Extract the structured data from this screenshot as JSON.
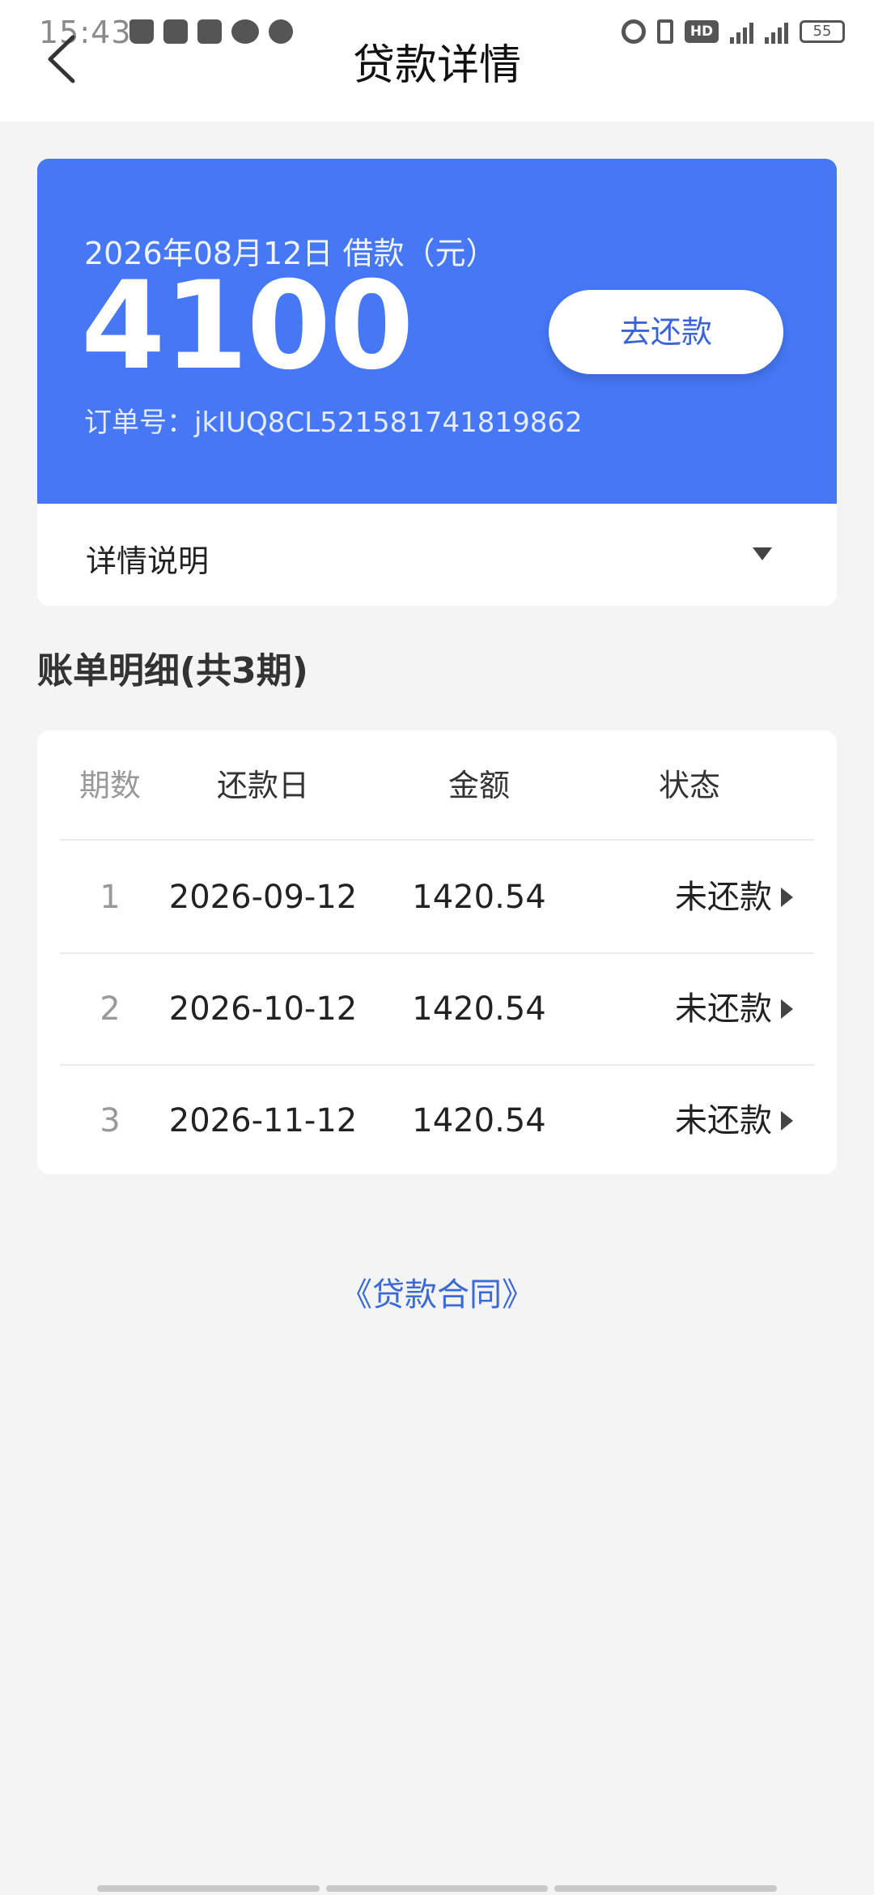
{
  "status_bar": {
    "time": "15:43",
    "battery": "55",
    "network": "4G+"
  },
  "header": {
    "title": "贷款详情"
  },
  "loan": {
    "date_label": "2026年08月12日 借款（元）",
    "amount": "4100",
    "order_no": "订单号：jkIUQ8CL521581741819862",
    "repay_label": "去还款"
  },
  "details": {
    "label": "详情说明"
  },
  "bill": {
    "section_title": "账单明细(共3期)",
    "headers": {
      "period": "期数",
      "date": "还款日",
      "amount": "金额",
      "status": "状态"
    },
    "rows": [
      {
        "period": "1",
        "date": "2026-09-12",
        "amount": "1420.54",
        "status": "未还款"
      },
      {
        "period": "2",
        "date": "2026-10-12",
        "amount": "1420.54",
        "status": "未还款"
      },
      {
        "period": "3",
        "date": "2026-11-12",
        "amount": "1420.54",
        "status": "未还款"
      }
    ]
  },
  "contract": {
    "link_label": "《贷款合同》"
  },
  "colors": {
    "accent": "#4677f5",
    "link": "#3a6ad6",
    "background": "#f4f4f5"
  }
}
